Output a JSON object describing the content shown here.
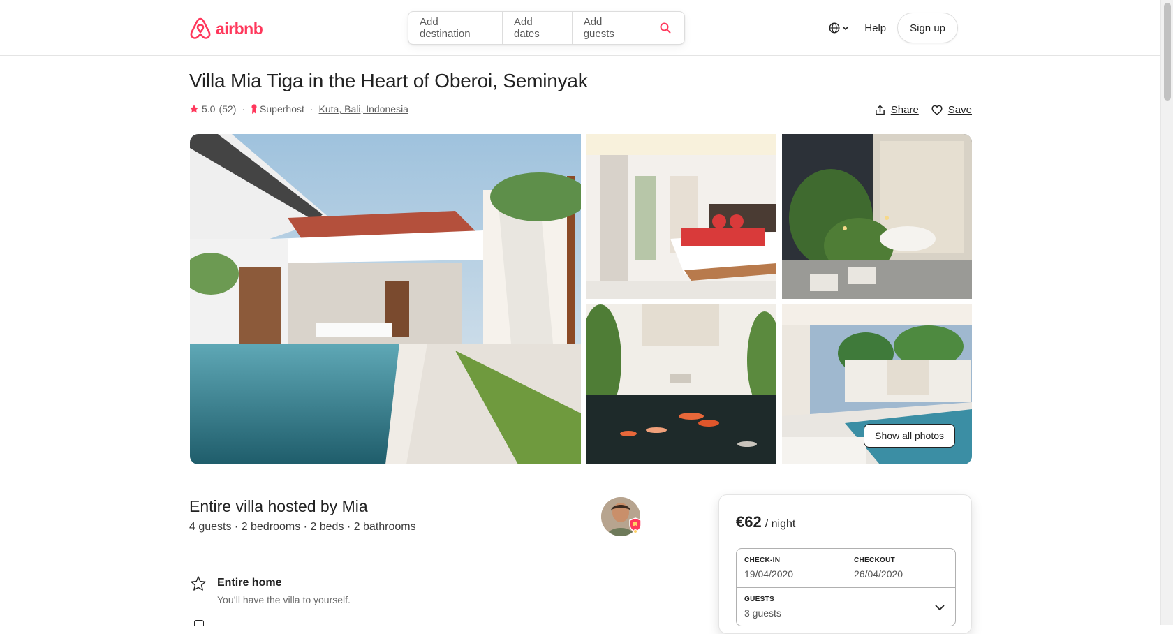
{
  "brand": {
    "name": "airbnb",
    "color": "#ff385c"
  },
  "search": {
    "destination": "Add destination",
    "dates": "Add dates",
    "guests": "Add guests"
  },
  "nav": {
    "language_icon": "globe-icon",
    "help": "Help",
    "signup": "Sign up"
  },
  "listing": {
    "title": "Villa Mia Tiga in the Heart of Oberoi, Seminyak",
    "rating": "5.0",
    "reviews": "(52)",
    "superhost": "Superhost",
    "location": "Kuta, Bali, Indonesia",
    "share": "Share",
    "save": "Save"
  },
  "gallery": {
    "photos": [
      "pool-exterior",
      "bedroom",
      "outdoor-bathtub",
      "koi-pond",
      "garden-pool"
    ],
    "show_all": "Show all photos"
  },
  "host": {
    "title": "Entire villa hosted by Mia",
    "details": "4 guests · 2 bedrooms · 2 beds · 2 bathrooms"
  },
  "features": [
    {
      "icon": "star-outline-icon",
      "title": "Entire home",
      "description": "You’ll have the villa to yourself."
    }
  ],
  "booking": {
    "price": "€62",
    "unit": "/ night",
    "checkin_label": "CHECK-IN",
    "checkin_value": "19/04/2020",
    "checkout_label": "CHECKOUT",
    "checkout_value": "26/04/2020",
    "guests_label": "GUESTS",
    "guests_value": "3 guests"
  }
}
